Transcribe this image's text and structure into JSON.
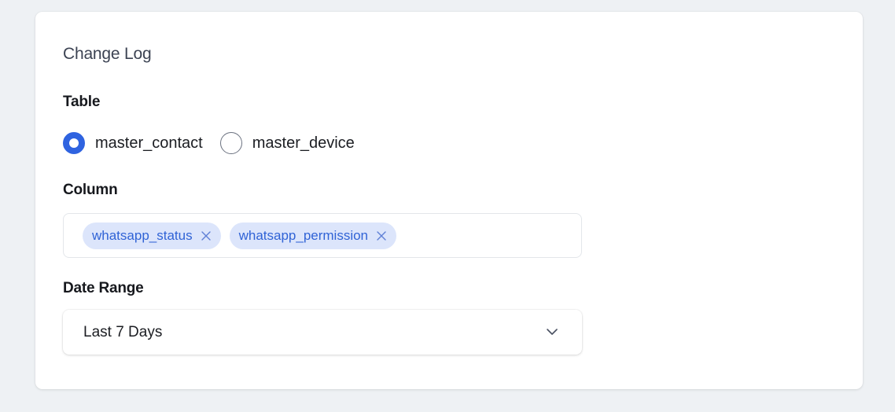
{
  "card": {
    "title": "Change Log"
  },
  "table": {
    "label": "Table",
    "options": [
      {
        "label": "master_contact",
        "checked": true
      },
      {
        "label": "master_device",
        "checked": false
      }
    ]
  },
  "column": {
    "label": "Column",
    "chips": [
      {
        "label": "whatsapp_status"
      },
      {
        "label": "whatsapp_permission"
      }
    ]
  },
  "date_range": {
    "label": "Date Range",
    "selected": "Last 7 Days"
  },
  "colors": {
    "accent": "#2f63e0",
    "chip_bg": "#dce5fb",
    "chip_text": "#3063d6",
    "page_bg": "#eef1f4"
  },
  "icons": {
    "chip_remove": "close-icon",
    "select_toggle": "chevron-down-icon"
  }
}
